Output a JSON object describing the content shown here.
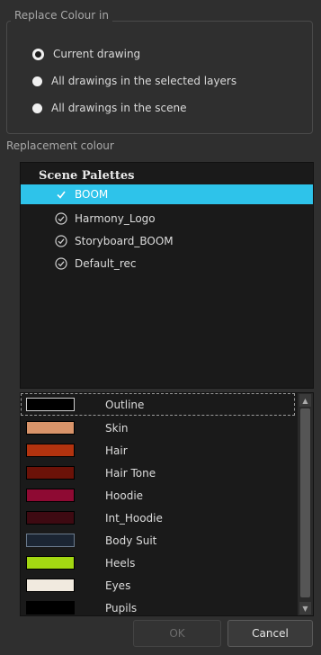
{
  "replace_group": {
    "title": "Replace Colour in",
    "options": [
      {
        "label": "Current drawing",
        "checked": true
      },
      {
        "label": "All drawings in the selected layers",
        "checked": false
      },
      {
        "label": "All drawings in the scene",
        "checked": false
      }
    ]
  },
  "replacement": {
    "label": "Replacement colour",
    "tree_header": "Scene Palettes",
    "palettes": [
      {
        "name": "BOOM",
        "selected": true
      },
      {
        "name": "Harmony_Logo",
        "selected": false
      },
      {
        "name": "Storyboard_BOOM",
        "selected": false
      },
      {
        "name": "Default_rec",
        "selected": false
      }
    ]
  },
  "swatches": [
    {
      "name": "Outline",
      "color": "#000000"
    },
    {
      "name": "Skin",
      "color": "#d9946a"
    },
    {
      "name": "Hair",
      "color": "#b2330f"
    },
    {
      "name": "Hair Tone",
      "color": "#6b1208"
    },
    {
      "name": "Hoodie",
      "color": "#8e0a33"
    },
    {
      "name": "Int_Hoodie",
      "color": "#3e0a12"
    },
    {
      "name": "Body Suit",
      "color": "#1b2533"
    },
    {
      "name": "Heels",
      "color": "#a3d712"
    },
    {
      "name": "Eyes",
      "color": "#f1eadf"
    },
    {
      "name": "Pupils",
      "color": "#000000"
    }
  ],
  "buttons": {
    "ok": "OK",
    "cancel": "Cancel"
  }
}
